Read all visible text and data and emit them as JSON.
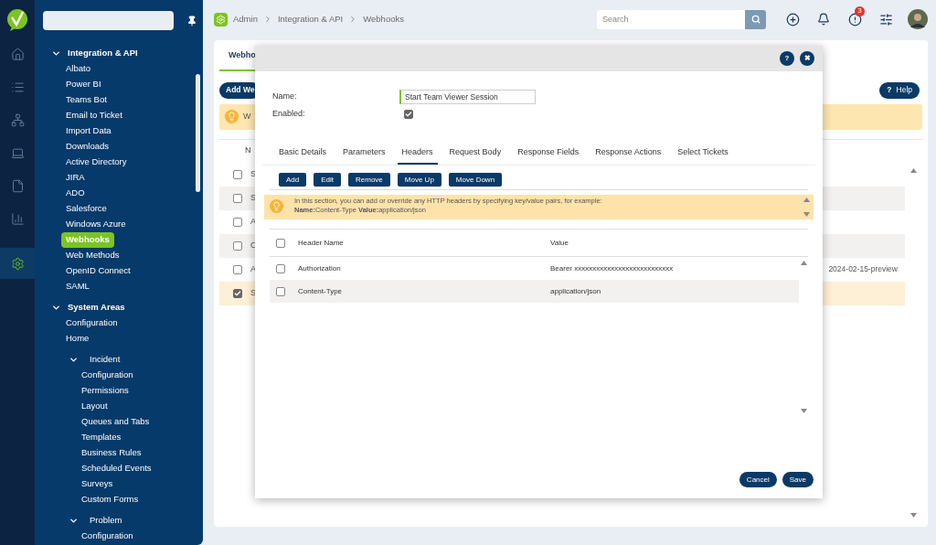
{
  "rail": {
    "items": [
      {
        "kind": "home",
        "selected": false
      },
      {
        "kind": "list",
        "selected": false
      },
      {
        "kind": "sitemap",
        "selected": false
      },
      {
        "kind": "laptop",
        "selected": false
      },
      {
        "kind": "file",
        "selected": false
      },
      {
        "kind": "chart",
        "selected": false
      },
      {
        "kind": "gear",
        "selected": true
      }
    ]
  },
  "sidebar": {
    "tree": [
      {
        "label": "Integration & API",
        "expanded": true,
        "selected": false,
        "children": [
          {
            "label": "Albato",
            "selected": false
          },
          {
            "label": "Power BI",
            "selected": false
          },
          {
            "label": "Teams Bot",
            "selected": false
          },
          {
            "label": "Email to Ticket",
            "selected": false
          },
          {
            "label": "Import Data",
            "selected": false
          },
          {
            "label": "Downloads",
            "selected": false
          },
          {
            "label": "Active Directory",
            "selected": false
          },
          {
            "label": "JIRA",
            "selected": false
          },
          {
            "label": "ADO",
            "selected": false
          },
          {
            "label": "Salesforce",
            "selected": false
          },
          {
            "label": "Windows Azure",
            "selected": false
          },
          {
            "label": "Webhooks",
            "selected": true
          },
          {
            "label": "Web Methods",
            "selected": false
          },
          {
            "label": "OpenID Connect",
            "selected": false
          },
          {
            "label": "SAML",
            "selected": false
          }
        ]
      },
      {
        "label": "System Areas",
        "expanded": true,
        "selected": false,
        "children": [
          {
            "label": "Configuration",
            "selected": false
          },
          {
            "label": "Home",
            "selected": false
          },
          {
            "label": "Incident",
            "expanded": true,
            "selected": false,
            "children": [
              {
                "label": "Configuration",
                "selected": false
              },
              {
                "label": "Permissions",
                "selected": false
              },
              {
                "label": "Layout",
                "selected": false
              },
              {
                "label": "Queues and Tabs",
                "selected": false
              },
              {
                "label": "Templates",
                "selected": false
              },
              {
                "label": "Business Rules",
                "selected": false
              },
              {
                "label": "Scheduled Events",
                "selected": false
              },
              {
                "label": "Surveys",
                "selected": false
              },
              {
                "label": "Custom Forms",
                "selected": false
              }
            ]
          },
          {
            "label": "Problem",
            "expanded": true,
            "selected": false,
            "children": [
              {
                "label": "Configuration",
                "selected": false
              }
            ]
          }
        ]
      }
    ]
  },
  "topbar": {
    "breadcrumb": [
      "Admin",
      "Integration & API",
      "Webhooks"
    ],
    "search": {
      "placeholder": "Search"
    },
    "alert_badge": "3"
  },
  "background": {
    "tab": "Webho",
    "add_button": "Add We",
    "info": "W",
    "help_button": {
      "icon": "?",
      "label": "Help"
    },
    "column": "N",
    "rows": [
      {
        "cell": "S",
        "checked": false,
        "selected": false
      },
      {
        "cell": "S",
        "checked": false,
        "selected": false
      },
      {
        "cell": "A",
        "checked": false,
        "selected": false
      },
      {
        "cell": "C",
        "checked": false,
        "selected": false
      },
      {
        "cell": "A",
        "checked": false,
        "selected": false,
        "column_2": "2024-02-15-preview"
      },
      {
        "cell": "S",
        "checked": true,
        "selected": true
      }
    ]
  },
  "modal": {
    "header_buttons": [
      "?",
      "✖"
    ],
    "name_label": "Name:",
    "name_value": "Start Team Viewer Session",
    "enabled_label": "Enabled:",
    "enabled": true,
    "tabs": [
      {
        "label": "Basic Details",
        "selected": false
      },
      {
        "label": "Parameters",
        "selected": false
      },
      {
        "label": "Headers",
        "selected": true
      },
      {
        "label": "Request Body",
        "selected": false
      },
      {
        "label": "Response Fields",
        "selected": false
      },
      {
        "label": "Response Actions",
        "selected": false
      },
      {
        "label": "Select Tickets",
        "selected": false
      }
    ],
    "toolbar": [
      "Add",
      "Edit",
      "Remove",
      "Move Up",
      "Move Down"
    ],
    "info_lines": [
      "In this section, you can add or override any HTTP headers by specifying key/value pairs, for example:",
      "**Name:**Content-Type **Value:**application/json"
    ],
    "table": {
      "columns": [
        "Header Name",
        "Value"
      ],
      "all_checked": false,
      "rows": [
        {
          "name": "Authorization",
          "value": "Bearer xxxxxxxxxxxxxxxxxxxxxxxxxxx",
          "checked": false
        },
        {
          "name": "Content-Type",
          "value": "application/json",
          "checked": false
        }
      ]
    },
    "footer": [
      "Cancel",
      "Save"
    ]
  }
}
